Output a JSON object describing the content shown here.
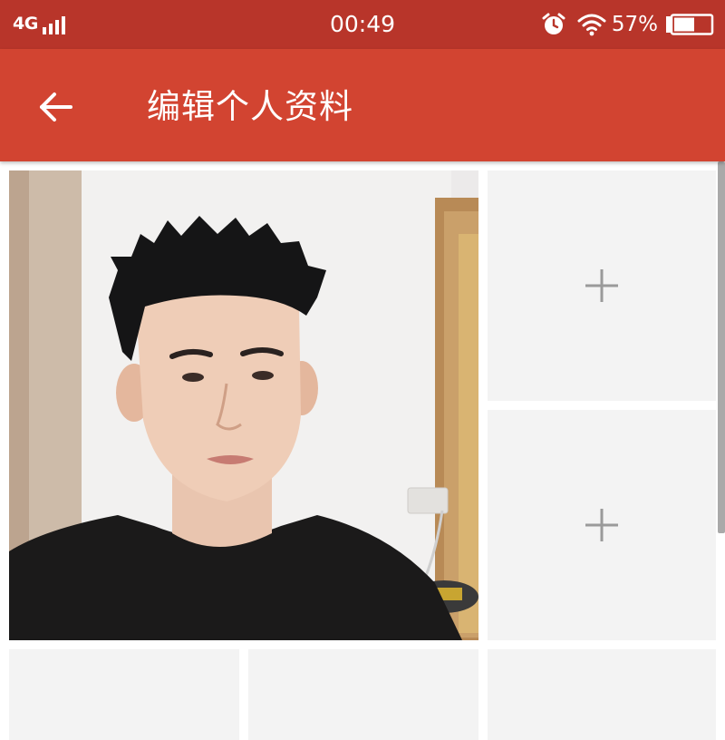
{
  "status_bar": {
    "network": "4G",
    "time": "00:49",
    "battery_percent": "57%",
    "battery_level": 0.57,
    "icons": [
      "signal-icon",
      "alarm-icon",
      "wifi-icon",
      "battery-icon"
    ]
  },
  "toolbar": {
    "title": "编辑个人资料",
    "back_icon": "arrow-left-icon"
  },
  "photos": {
    "main_photo": "profile-photo",
    "empty_slot_icon": "plus-icon",
    "empty_slots": 5
  },
  "colors": {
    "status_bar_bg": "#b8352a",
    "toolbar_bg": "#d24431",
    "slot_bg": "#f3f3f3",
    "plus_color": "#9a9a9a"
  }
}
